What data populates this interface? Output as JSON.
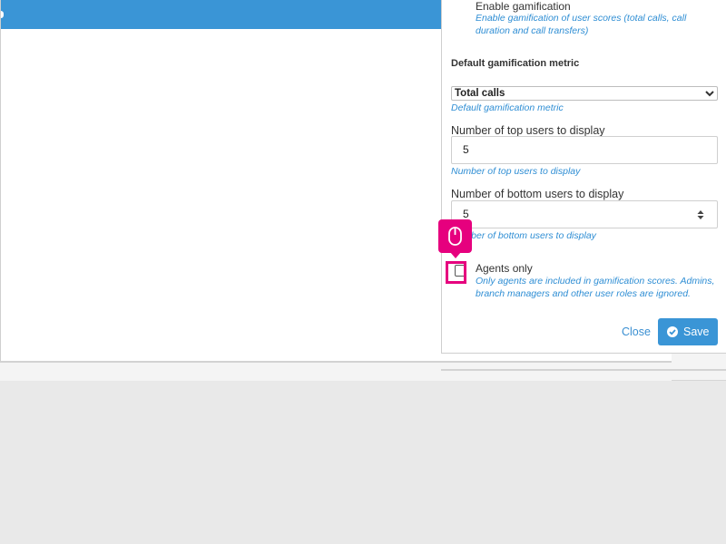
{
  "panel": {
    "enable_gamification": {
      "label": "Enable gamification",
      "help": "Enable gamification of user scores (total calls, call duration and call transfers)"
    },
    "default_metric": {
      "title": "Default gamification metric",
      "selected": "Total calls",
      "help": "Default gamification metric"
    },
    "top_users": {
      "label": "Number of top users to display",
      "value": "5",
      "help": "Number of top users to display"
    },
    "bottom_users": {
      "label": "Number of bottom users to display",
      "value": "5",
      "help": "Number of bottom users to display"
    },
    "agents_only": {
      "label": "Agents only",
      "help": "Only agents are included in gamification scores. Admins, branch managers and other user roles are ignored.",
      "checked": false
    },
    "actions": {
      "close_label": "Close",
      "save_label": "Save"
    }
  },
  "icons": {
    "select_chevron": "chevron-down-icon",
    "spinner": "spinner-arrows-icon",
    "save": "check-circle-icon",
    "cursor": "mouse-icon"
  },
  "colors": {
    "accent": "#3a95d6",
    "help_text": "#2f8ed4",
    "highlight": "#e6007e"
  }
}
